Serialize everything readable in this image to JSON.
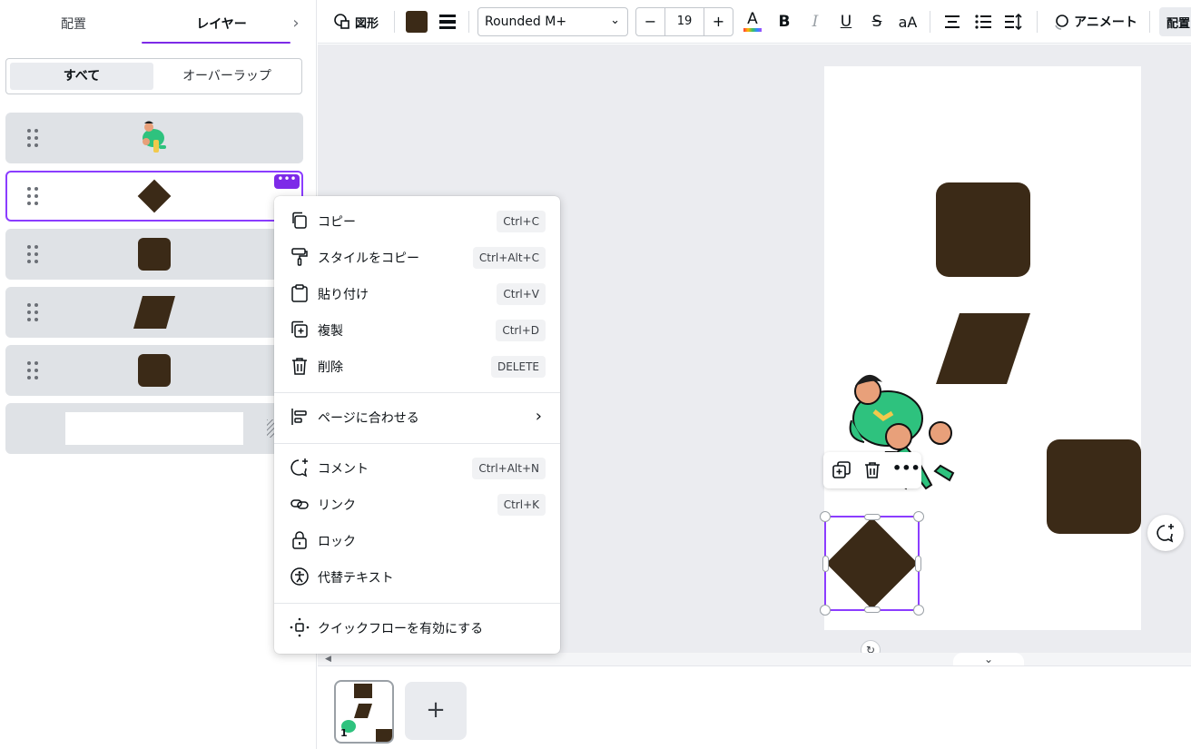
{
  "left_panel": {
    "tabs": {
      "arrange": "配置",
      "layers": "レイヤー"
    },
    "segmented": {
      "all": "すべて",
      "overlap": "オーバーラップ"
    }
  },
  "toolbar": {
    "shape_label": "図形",
    "fill_color": "#3b2a17",
    "font_name": "Rounded M+",
    "font_size": "19",
    "minus": "−",
    "plus": "+",
    "text_color_letter": "A",
    "bold": "B",
    "italic": "I",
    "underline": "U",
    "strike": "S",
    "case": "aA",
    "animate_label": "アニメート",
    "arrange_label": "配置"
  },
  "context_menu": {
    "items": [
      {
        "label": "コピー",
        "shortcut": "Ctrl+C",
        "icon": "copy-icon"
      },
      {
        "label": "スタイルをコピー",
        "shortcut": "Ctrl+Alt+C",
        "icon": "paint-roller-icon"
      },
      {
        "label": "貼り付け",
        "shortcut": "Ctrl+V",
        "icon": "clipboard-icon"
      },
      {
        "label": "複製",
        "shortcut": "Ctrl+D",
        "icon": "duplicate-icon"
      },
      {
        "label": "削除",
        "shortcut": "DELETE",
        "icon": "trash-icon"
      },
      {
        "label": "ページに合わせる",
        "icon": "align-page-icon"
      },
      {
        "label": "コメント",
        "shortcut": "Ctrl+Alt+N",
        "icon": "comment-icon"
      },
      {
        "label": "リンク",
        "shortcut": "Ctrl+K",
        "icon": "link-icon"
      },
      {
        "label": "ロック",
        "icon": "lock-icon"
      },
      {
        "label": "代替テキスト",
        "icon": "accessibility-icon"
      },
      {
        "label": "クイックフローを有効にする",
        "icon": "quickflow-icon"
      }
    ]
  },
  "filmstrip": {
    "page_number": "1",
    "add_page": "+"
  },
  "colors": {
    "accent": "#8b3dff",
    "shape": "#3b2a17",
    "canvas_bg": "#ebecf0"
  }
}
